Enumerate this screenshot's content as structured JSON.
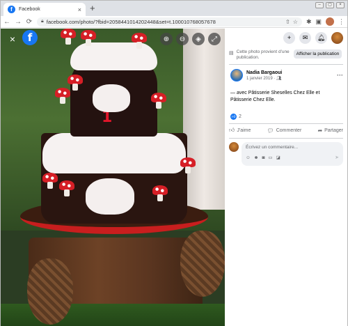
{
  "browser": {
    "tab_title": "Facebook",
    "tab_close": "×",
    "new_tab": "+",
    "url": "facebook.com/photo/?fbid=2058441014202448&set=t.100010768057678",
    "back_icon": "←",
    "forward_icon": "→",
    "reload_icon": "C",
    "window_minimize": "–",
    "window_maximize": "▢",
    "window_close": "×"
  },
  "photo": {
    "close_icon": "×",
    "logo_letter": "f",
    "number_on_cake": "1"
  },
  "panel": {
    "notice_text": "Cette photo provient d'une publication.",
    "notice_button": "Afficher la publication",
    "author_name": "Nadia Bargaoui",
    "post_date": "1 janvier 2019 · ",
    "post_text": "— avec Pâtisserie Sheselles Chez Elle et Pâtisserie Chez Elle.",
    "reaction_count": "2",
    "actions": {
      "like": "J'aime",
      "comment": "Commenter",
      "share": "Partager"
    },
    "comment_placeholder": "Écrivez un commentaire..."
  },
  "colors": {
    "facebook_blue": "#1877f2",
    "like_blue": "#1877f2",
    "secondary_text": "#65676b"
  }
}
